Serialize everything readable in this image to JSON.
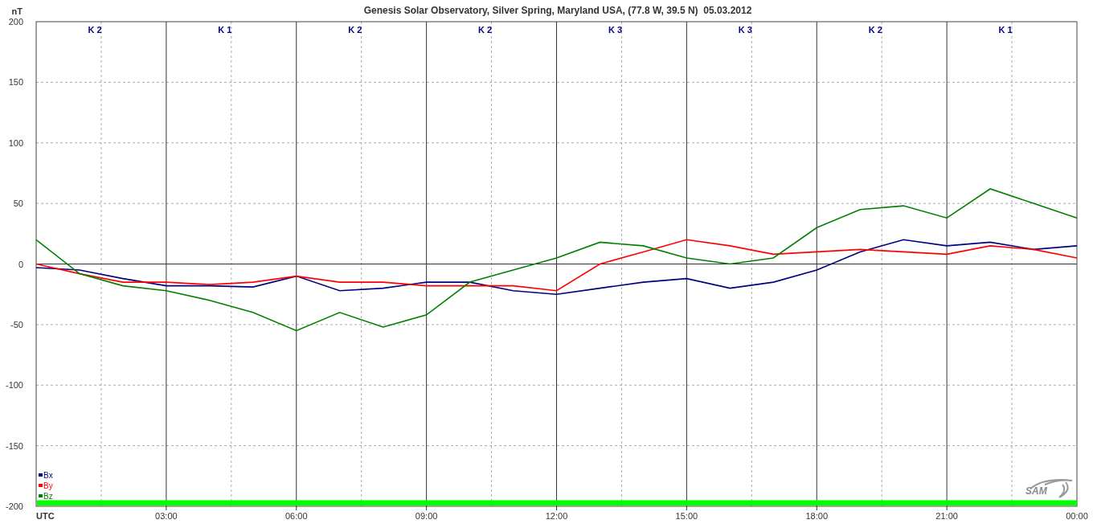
{
  "chart": {
    "title": "Genesis Solar Observatory, Silver Spring, Maryland USA, (77.8 W, 39.5 N)  05.03.2012",
    "unit": "nT",
    "time_label": "UTC",
    "logo": "SAM",
    "k_indices": [
      "K 2",
      "K 1",
      "K 2",
      "K 2",
      "K 3",
      "K 3",
      "K 2",
      "K 1"
    ],
    "chart_data": {
      "type": "line",
      "grid": true,
      "legend": "bottom-left",
      "xlim": [
        0,
        24
      ],
      "ylim": [
        -200,
        200
      ],
      "bands": [
        {
          "axis": "y",
          "from": -200,
          "to": -195,
          "color": "#00ff00"
        }
      ],
      "x": [
        0,
        1,
        2,
        3,
        4,
        5,
        6,
        7,
        8,
        9,
        10,
        11,
        12,
        13,
        14,
        15,
        16,
        17,
        18,
        19,
        20,
        21,
        22,
        23,
        24
      ],
      "yticks": [
        -200,
        -150,
        -100,
        -50,
        0,
        50,
        100,
        150,
        200
      ],
      "xticks": [
        {
          "value": 3,
          "label": "03:00"
        },
        {
          "value": 6,
          "label": "06:00"
        },
        {
          "value": 9,
          "label": "09:00"
        },
        {
          "value": 12,
          "label": "12:00"
        },
        {
          "value": 15,
          "label": "15:00"
        },
        {
          "value": 18,
          "label": "18:00"
        },
        {
          "value": 21,
          "label": "21:00"
        },
        {
          "value": 24,
          "label": "00:00"
        }
      ],
      "series": [
        {
          "name": "Bx",
          "color": "#000080",
          "values": [
            -3,
            -5,
            -12,
            -18,
            -18,
            -19,
            -10,
            -22,
            -20,
            -15,
            -15,
            -22,
            -25,
            -20,
            -15,
            -12,
            -20,
            -15,
            -5,
            10,
            20,
            15,
            18,
            12,
            15
          ]
        },
        {
          "name": "By",
          "color": "#ff0000",
          "values": [
            0,
            -8,
            -15,
            -15,
            -17,
            -15,
            -10,
            -15,
            -15,
            -18,
            -18,
            -18,
            -22,
            0,
            10,
            20,
            15,
            8,
            10,
            12,
            10,
            8,
            15,
            12,
            5
          ]
        },
        {
          "name": "Bz",
          "color": "#008000",
          "values": [
            20,
            -8,
            -18,
            -22,
            -30,
            -40,
            -55,
            -40,
            -52,
            -42,
            -15,
            -5,
            5,
            18,
            15,
            5,
            0,
            5,
            30,
            45,
            48,
            38,
            62,
            50,
            38
          ]
        }
      ]
    }
  }
}
